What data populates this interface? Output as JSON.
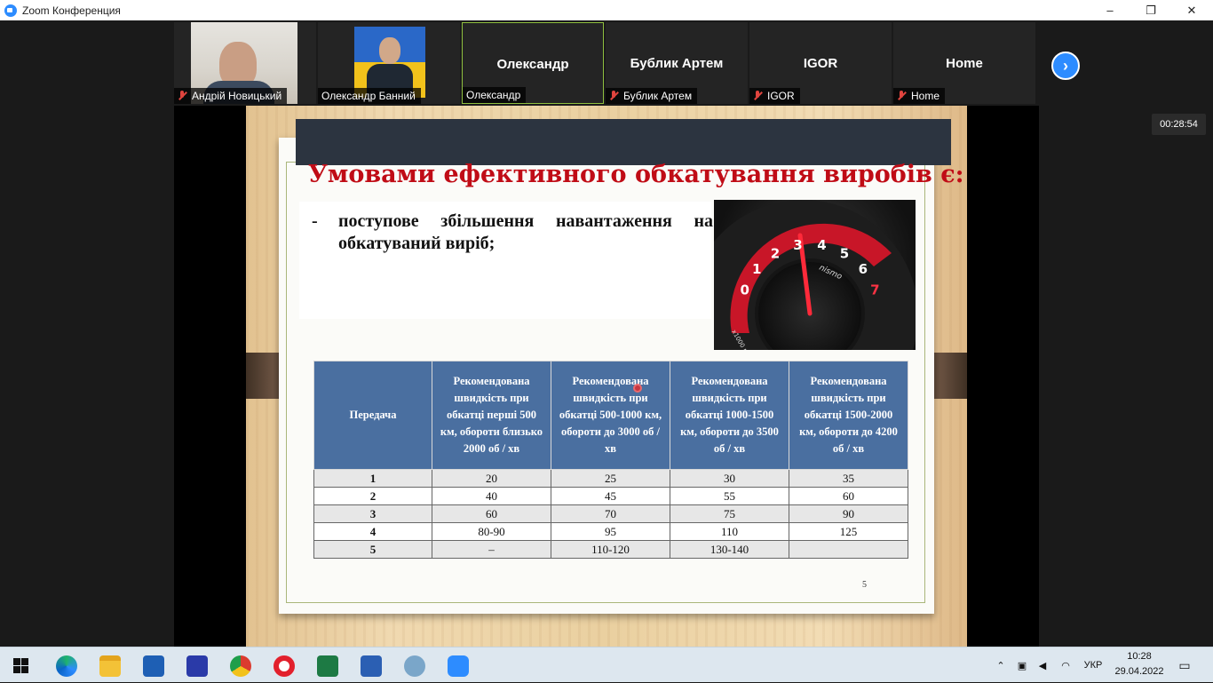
{
  "window": {
    "title": "Zoom Конференция",
    "controls": [
      "–",
      "❐",
      "✕"
    ]
  },
  "participants": [
    {
      "name": "Андрій Новицький",
      "muted": true,
      "video": true
    },
    {
      "name": "Олександр Банний",
      "muted": false,
      "video": true
    },
    {
      "name": "Олександр",
      "muted": false,
      "video": false,
      "active": true
    },
    {
      "name": "Бублик Артем",
      "muted": true,
      "video": false
    },
    {
      "name": "IGOR",
      "muted": true,
      "video": false
    },
    {
      "name": "Home",
      "muted": true,
      "video": false
    }
  ],
  "next_arrow": "›",
  "timer": "00:28:54",
  "slide": {
    "title": "Умовами ефективного обкатування виробів є:",
    "bullet_dash": "-",
    "bullet_text": "поступове збільшення навантаження на обкатуваний виріб;",
    "page_number": "5",
    "table": {
      "headers": [
        "Передача",
        "Рекомендована швидкість при обкатці перші 500 км, обороти близько 2000 об / хв",
        "Рекомендована швидкість при обкатці 500-1000 км, обороти до 3000 об / хв",
        "Рекомендована швидкість при обкатці 1000-1500 км, обороти до 3500 об / хв",
        "Рекомендована швидкість при обкатці 1500-2000 км, обороти до 4200 об / хв"
      ],
      "rows": [
        [
          "1",
          "20",
          "25",
          "30",
          "35"
        ],
        [
          "2",
          "40",
          "45",
          "55",
          "60"
        ],
        [
          "3",
          "60",
          "70",
          "75",
          "90"
        ],
        [
          "4",
          "80-90",
          "95",
          "110",
          "125"
        ],
        [
          "5",
          "–",
          "110-120",
          "130-140",
          ""
        ]
      ]
    },
    "gauge": {
      "ticks": [
        "0",
        "1",
        "2",
        "3",
        "4",
        "5",
        "6",
        "7"
      ],
      "brand": "nismo",
      "unit": "x1000 r/min"
    }
  },
  "taskbar": {
    "language": "УКР",
    "time": "10:28",
    "date": "29.04.2022"
  },
  "colors": {
    "zoom_blue": "#2d8cff",
    "slide_title_red": "#c00c16",
    "table_header_blue": "#4a6fa0",
    "active_tile_border": "#8fbf3f"
  }
}
